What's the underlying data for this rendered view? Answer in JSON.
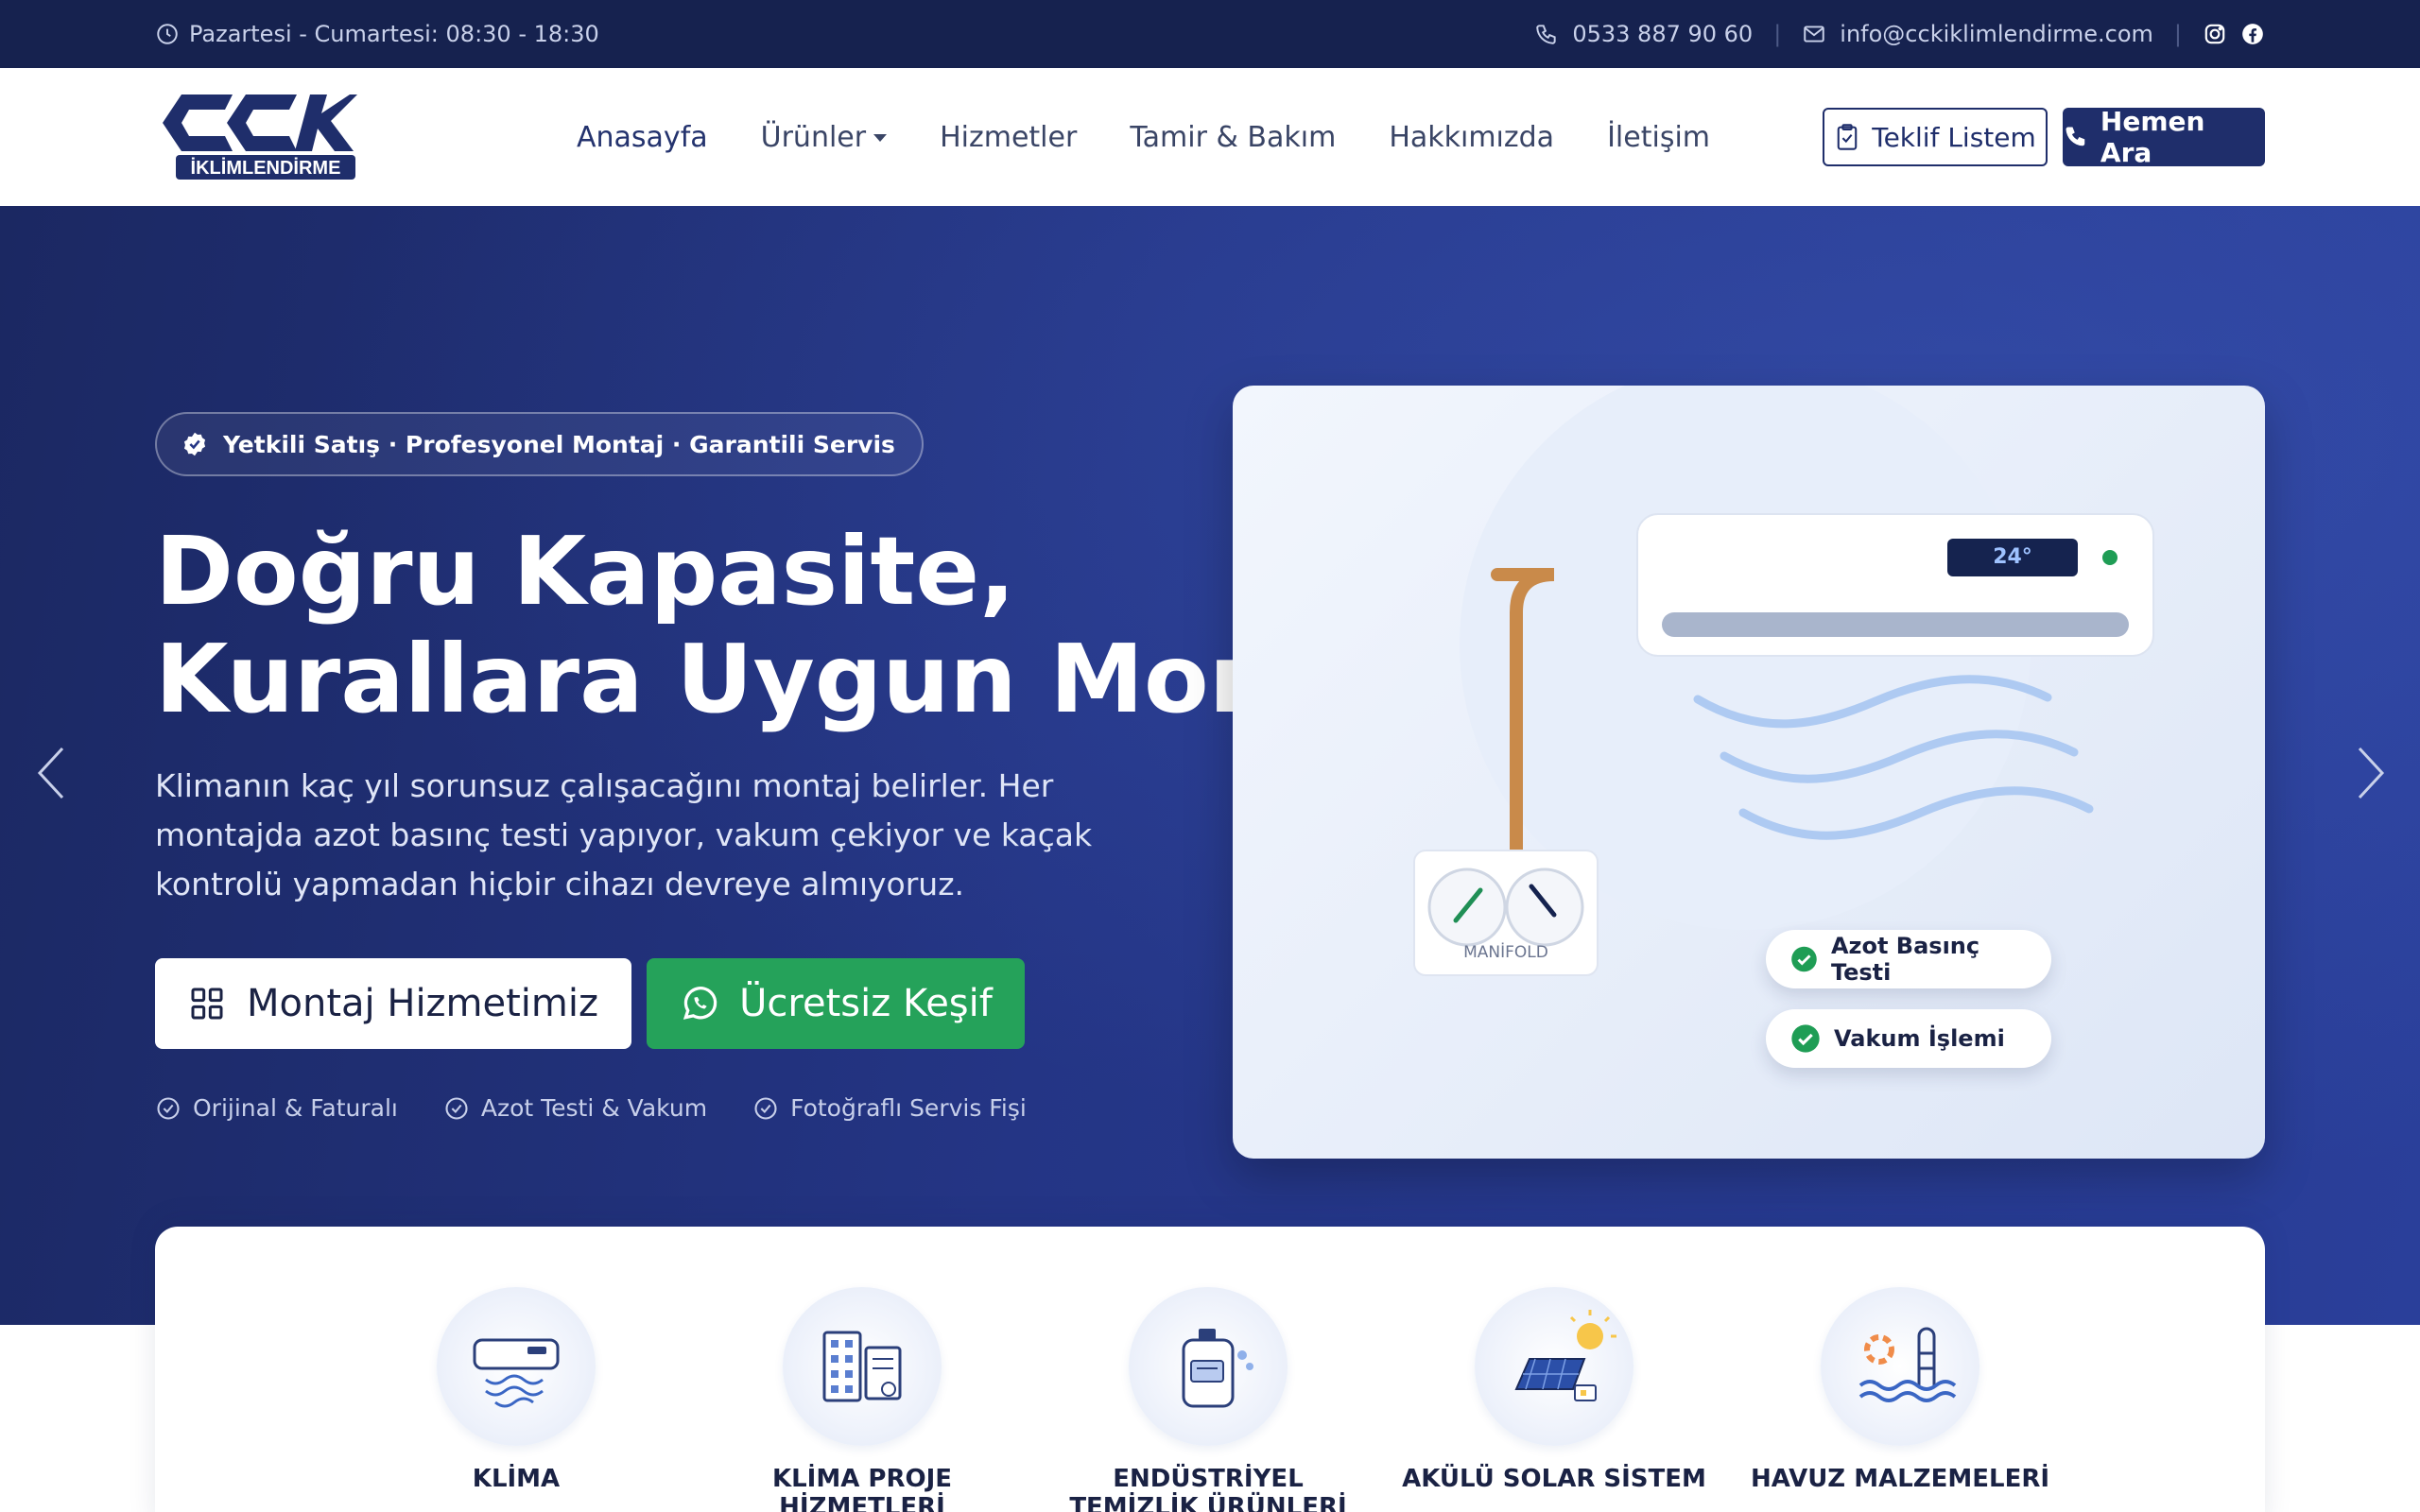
{
  "topbar": {
    "hours": "Pazartesi - Cumartesi: 08:30 - 18:30",
    "phone": "0533 887 90 60",
    "email": "info@cckiklimlendirme.com",
    "icons": [
      "clock-icon",
      "phone-icon",
      "mail-icon",
      "instagram-icon",
      "facebook-icon"
    ]
  },
  "logo": {
    "mark": "CCK",
    "sub": "İKLİMLENDİRME"
  },
  "nav": {
    "items": [
      {
        "label": "Anasayfa",
        "active": true
      },
      {
        "label": "Ürünler",
        "dropdown": true
      },
      {
        "label": "Hizmetler"
      },
      {
        "label": "Tamir & Bakım"
      },
      {
        "label": "Hakkımızda"
      },
      {
        "label": "İletişim"
      }
    ],
    "quote_button": "Teklif Listem",
    "call_button": "Hemen Ara"
  },
  "hero": {
    "badge": "Yetkili Satış · Profesyonel Montaj · Garantili Servis",
    "title_line1": "Doğru Kapasite,",
    "title_line2": "Kurallara Uygun Montaj",
    "subtitle": "Klimanın kaç yıl sorunsuz çalışacağını montaj belirler. Her montajda azot basınç testi yapıyor, vakum çekiyor ve kaçak kontrolü yapmadan hiçbir cihazı devreye almıyoruz.",
    "primary_button": "Montaj Hizmetimiz",
    "secondary_button": "Ücretsiz Keşif",
    "features": [
      "Orijinal & Faturalı",
      "Azot Testi & Vakum",
      "Fotoğraflı Servis Fişi"
    ],
    "illustration": {
      "ac_display": "24°",
      "manifold_label": "MANİFOLD",
      "checks": [
        "Azot Basınç Testi",
        "Vakum İşlemi"
      ]
    }
  },
  "categories": [
    {
      "label": "KLİMA",
      "icon": "ac-unit-icon"
    },
    {
      "label": "KLİMA PROJE HİZMETLERİ",
      "icon": "building-plan-icon"
    },
    {
      "label": "ENDÜSTRİYEL TEMİZLİK ÜRÜNLERİ",
      "icon": "cleaning-product-icon"
    },
    {
      "label": "AKÜLÜ SOLAR SİSTEM",
      "icon": "solar-panel-icon"
    },
    {
      "label": "HAVUZ MALZEMELERİ",
      "icon": "pool-icon"
    }
  ],
  "colors": {
    "topbar_bg": "#16224f",
    "brand_navy": "#1f2e6b",
    "whatsapp_green": "#25a25a",
    "hero_gradient_start": "#1b2862",
    "hero_gradient_end": "#2a3f9a"
  }
}
